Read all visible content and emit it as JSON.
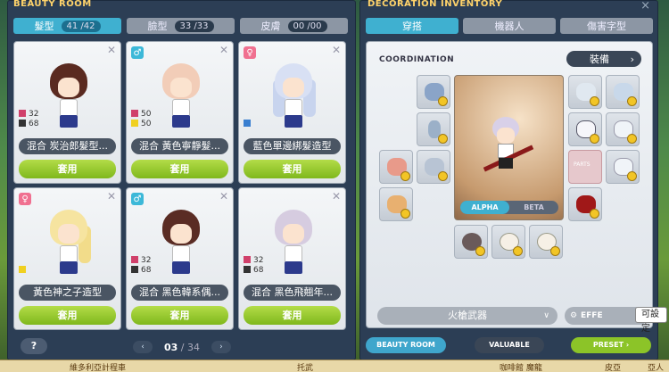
{
  "left_window": {
    "title": "BEAUTY ROOM",
    "tabs": [
      {
        "label": "髮型",
        "count": "41 /42"
      },
      {
        "label": "臉型",
        "count": "33 /33"
      },
      {
        "label": "皮膚",
        "count": "00 /00"
      }
    ],
    "cards": [
      {
        "gender": "",
        "stat1": "32",
        "stat2": "68",
        "name": "混合 炭治郎髮型...",
        "apply": "套用"
      },
      {
        "gender": "♂",
        "stat1": "50",
        "stat2": "50",
        "name": "混合 黃色寧靜髮...",
        "apply": "套用"
      },
      {
        "gender": "♀",
        "stat1": "",
        "stat2": "",
        "name": "藍色單邊綁髮造型",
        "apply": "套用"
      },
      {
        "gender": "♀",
        "stat1": "",
        "stat2": "",
        "name": "黃色神之子造型",
        "apply": "套用"
      },
      {
        "gender": "♂",
        "stat1": "32",
        "stat2": "68",
        "name": "混合 黑色韓系偶...",
        "apply": "套用"
      },
      {
        "gender": "",
        "stat1": "32",
        "stat2": "68",
        "name": "混合 黑色飛翹年...",
        "apply": "套用"
      }
    ],
    "help": "?",
    "pager": {
      "prev": "‹",
      "current": "03",
      "total": "/ 34",
      "next": "›"
    }
  },
  "right_window": {
    "title": "DECORATION INVENTORY",
    "close": "×",
    "tabs": [
      "穿搭",
      "機器人",
      "傷害字型"
    ],
    "coordination_label": "COORDINATION",
    "equip_button": "裝備",
    "alpha_label": "ALPHA",
    "beta_label": "BETA",
    "parts_label": "PARTS",
    "weapon_dropdown": "火槍武器",
    "effect_button": "EFFE",
    "bottom_buttons": [
      "BEAUTY ROOM",
      "VALUABLE",
      "PRESET"
    ]
  },
  "tooltip": "可設定",
  "bottom_bar": {
    "left": "維多利亞計程車",
    "mid": "托武",
    "right": "咖啡館 魔龍",
    "right2": "皮亞",
    "right3": "亞人"
  },
  "colors": {
    "active_tab": "#3fb0d0",
    "apply_green": "#8cc428",
    "window_bg": "#2c3e55",
    "stat_red": "#d0406a",
    "stat_dark": "#333333",
    "stat_yellow": "#f0d020",
    "stat_blue": "#3a7fd0"
  }
}
